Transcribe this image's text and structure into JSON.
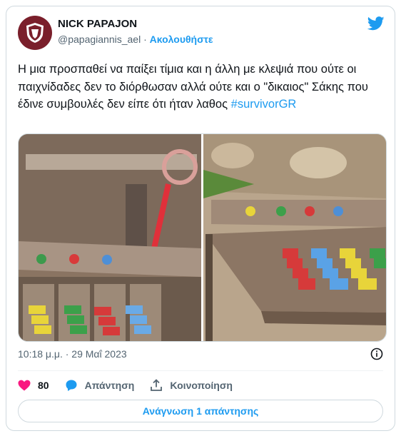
{
  "author": {
    "name": "NICK PAPAJON",
    "handle": "@papagiannis_ael",
    "separator": "·",
    "follow_label": "Ακολουθήστε"
  },
  "tweet": {
    "text": "Η μια προσπαθεί να παίξει τίμια και η άλλη με κλεψιά που ούτε οι παιχνίδαδες  δεν το διόρθωσαν  αλλά ούτε και ο  \"δικαιος\" Σάκης που έδινε συμβουλές δεν είπε ότι ήταν λαθος ",
    "hashtag": "#survivorGR",
    "timestamp": "10:18 μ.μ. · 29 Μαΐ 2023"
  },
  "actions": {
    "likes_count": "80",
    "reply_label": "Απάντηση",
    "share_label": "Κοινοποίηση"
  },
  "read_replies_label": "Ανάγνωση 1 απάντησης",
  "colors": {
    "accent": "#1d9bf0",
    "like": "#f91880",
    "secondary_text": "#536471",
    "avatar_bg": "#7a1f2b"
  },
  "icons": [
    "club-logo-icon",
    "twitter-bird-icon",
    "info-icon",
    "heart-icon",
    "reply-icon",
    "share-icon"
  ]
}
